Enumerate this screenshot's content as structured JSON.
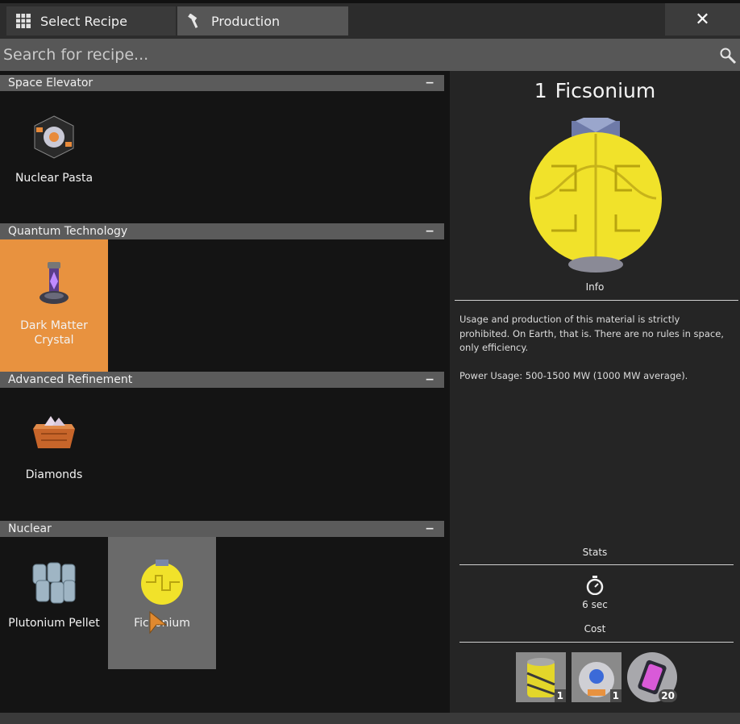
{
  "tabs": [
    {
      "label": "Select Recipe",
      "icon": "grid-icon"
    },
    {
      "label": "Production",
      "icon": "hammer-icon"
    }
  ],
  "close_label": "✕",
  "search": {
    "placeholder": "Search for recipe..."
  },
  "categories": [
    {
      "name": "Space Elevator",
      "collapse": "−",
      "items": [
        {
          "label": "Nuclear Pasta"
        }
      ]
    },
    {
      "name": "Quantum Technology",
      "collapse": "−",
      "items": [
        {
          "label": "Dark Matter Crystal"
        }
      ]
    },
    {
      "name": "Advanced Refinement",
      "collapse": "−",
      "items": [
        {
          "label": "Diamonds"
        }
      ]
    },
    {
      "name": "Nuclear",
      "collapse": "−",
      "items": [
        {
          "label": "Plutonium Pellet"
        },
        {
          "label": "Ficsonium"
        }
      ]
    }
  ],
  "detail": {
    "quantity": "1",
    "name": "Ficsonium",
    "info_label": "Info",
    "description": "Usage and production of this material is strictly prohibited. On Earth, that is. There are no rules in space, only efficiency.",
    "power_usage": "Power Usage: 500-1500 MW (1000 MW average).",
    "stats_label": "Stats",
    "time": "6 sec",
    "cost_label": "Cost",
    "costs": [
      {
        "count": "1",
        "icon": "plutonium-waste-icon"
      },
      {
        "count": "1",
        "icon": "singularity-cell-icon"
      },
      {
        "count": "20",
        "icon": "dark-matter-residue-icon"
      }
    ]
  },
  "colors": {
    "selected": "#e8923f",
    "accent_yellow": "#f1e22a"
  }
}
